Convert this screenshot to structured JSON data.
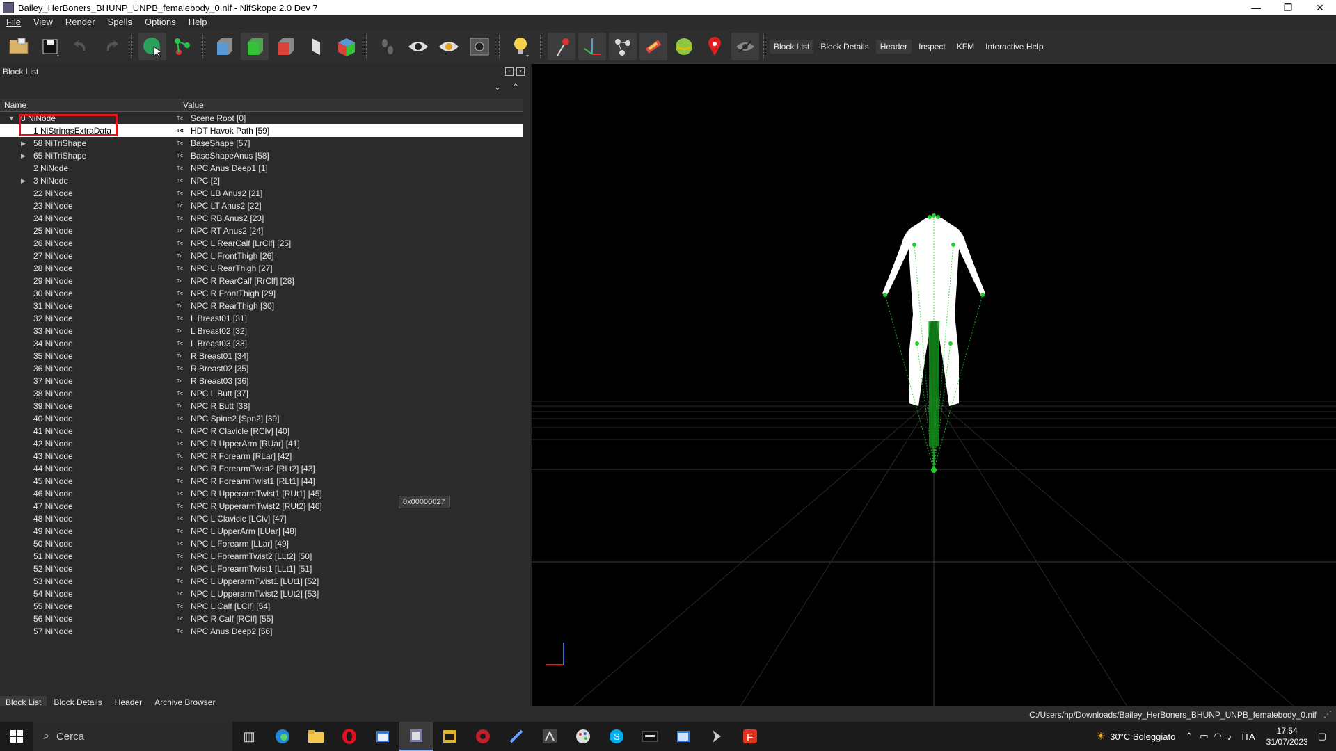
{
  "window": {
    "title": "Bailey_HerBoners_BHUNP_UNPB_femalebody_0.nif - NifSkope 2.0 Dev 7",
    "minimize": "—",
    "maximize": "❐",
    "close": "✕"
  },
  "menu": [
    "File",
    "View",
    "Render",
    "Spells",
    "Options",
    "Help"
  ],
  "toolbar_tabs": [
    "Block List",
    "Block Details",
    "Header",
    "Inspect",
    "KFM",
    "Interactive Help"
  ],
  "panel": {
    "title": "Block List",
    "col_name": "Name",
    "col_value": "Value",
    "rows": [
      {
        "name": "0 NiNode",
        "value": "Scene Root [0]",
        "type": "Txt"
      },
      {
        "name": "1 NiStringsExtraData",
        "value": "HDT Havok Path [59]",
        "type": "Txt"
      },
      {
        "name": "58 NiTriShape",
        "value": "BaseShape [57]",
        "type": "Txt"
      },
      {
        "name": "65 NiTriShape",
        "value": "BaseShapeAnus [58]",
        "type": "Txt"
      },
      {
        "name": "2 NiNode",
        "value": "NPC Anus Deep1 [1]",
        "type": "Txt"
      },
      {
        "name": "3 NiNode",
        "value": "NPC [2]",
        "type": "Txt"
      },
      {
        "name": "22 NiNode",
        "value": "NPC LB Anus2 [21]",
        "type": "Txt"
      },
      {
        "name": "23 NiNode",
        "value": "NPC LT Anus2 [22]",
        "type": "Txt"
      },
      {
        "name": "24 NiNode",
        "value": "NPC RB Anus2 [23]",
        "type": "Txt"
      },
      {
        "name": "25 NiNode",
        "value": "NPC RT Anus2 [24]",
        "type": "Txt"
      },
      {
        "name": "26 NiNode",
        "value": "NPC L RearCalf [LrClf] [25]",
        "type": "Txt"
      },
      {
        "name": "27 NiNode",
        "value": "NPC L FrontThigh [26]",
        "type": "Txt"
      },
      {
        "name": "28 NiNode",
        "value": "NPC L RearThigh [27]",
        "type": "Txt"
      },
      {
        "name": "29 NiNode",
        "value": "NPC R RearCalf [RrClf] [28]",
        "type": "Txt"
      },
      {
        "name": "30 NiNode",
        "value": "NPC R FrontThigh [29]",
        "type": "Txt"
      },
      {
        "name": "31 NiNode",
        "value": "NPC R RearThigh [30]",
        "type": "Txt"
      },
      {
        "name": "32 NiNode",
        "value": "L Breast01 [31]",
        "type": "Txt"
      },
      {
        "name": "33 NiNode",
        "value": "L Breast02 [32]",
        "type": "Txt"
      },
      {
        "name": "34 NiNode",
        "value": "L Breast03 [33]",
        "type": "Txt"
      },
      {
        "name": "35 NiNode",
        "value": "R Breast01 [34]",
        "type": "Txt"
      },
      {
        "name": "36 NiNode",
        "value": "R Breast02 [35]",
        "type": "Txt"
      },
      {
        "name": "37 NiNode",
        "value": "R Breast03 [36]",
        "type": "Txt"
      },
      {
        "name": "38 NiNode",
        "value": "NPC L Butt [37]",
        "type": "Txt"
      },
      {
        "name": "39 NiNode",
        "value": "NPC R Butt [38]",
        "type": "Txt"
      },
      {
        "name": "40 NiNode",
        "value": "NPC Spine2 [Spn2] [39]",
        "type": "Txt"
      },
      {
        "name": "41 NiNode",
        "value": "NPC R Clavicle [RClv] [40]",
        "type": "Txt"
      },
      {
        "name": "42 NiNode",
        "value": "NPC R UpperArm [RUar] [41]",
        "type": "Txt"
      },
      {
        "name": "43 NiNode",
        "value": "NPC R Forearm [RLar] [42]",
        "type": "Txt"
      },
      {
        "name": "44 NiNode",
        "value": "NPC R ForearmTwist2 [RLt2] [43]",
        "type": "Txt"
      },
      {
        "name": "45 NiNode",
        "value": "NPC R ForearmTwist1 [RLt1] [44]",
        "type": "Txt"
      },
      {
        "name": "46 NiNode",
        "value": "NPC R UpperarmTwist1 [RUt1] [45]",
        "type": "Txt"
      },
      {
        "name": "47 NiNode",
        "value": "NPC R UpperarmTwist2 [RUt2] [46]",
        "type": "Txt"
      },
      {
        "name": "48 NiNode",
        "value": "NPC L Clavicle [LClv] [47]",
        "type": "Txt"
      },
      {
        "name": "49 NiNode",
        "value": "NPC L UpperArm [LUar] [48]",
        "type": "Txt"
      },
      {
        "name": "50 NiNode",
        "value": "NPC L Forearm [LLar] [49]",
        "type": "Txt"
      },
      {
        "name": "51 NiNode",
        "value": "NPC L ForearmTwist2 [LLt2] [50]",
        "type": "Txt"
      },
      {
        "name": "52 NiNode",
        "value": "NPC L ForearmTwist1 [LLt1] [51]",
        "type": "Txt"
      },
      {
        "name": "53 NiNode",
        "value": "NPC L UpperarmTwist1 [LUt1] [52]",
        "type": "Txt"
      },
      {
        "name": "54 NiNode",
        "value": "NPC L UpperarmTwist2 [LUt2] [53]",
        "type": "Txt"
      },
      {
        "name": "55 NiNode",
        "value": "NPC L Calf [LClf] [54]",
        "type": "Txt"
      },
      {
        "name": "56 NiNode",
        "value": "NPC R Calf [RClf] [55]",
        "type": "Txt"
      },
      {
        "name": "57 NiNode",
        "value": "NPC Anus Deep2 [56]",
        "type": "Txt"
      }
    ],
    "expandable_rows": [
      0,
      2,
      3,
      5
    ],
    "selected_row": 1,
    "tooltip": "0x00000027"
  },
  "bottom_tabs": [
    "Block List",
    "Block Details",
    "Header",
    "Archive Browser"
  ],
  "status": {
    "path": "C:/Users/hp/Downloads/Bailey_HerBoners_BHUNP_UNPB_femalebody_0.nif"
  },
  "taskbar": {
    "search_placeholder": "Cerca",
    "weather": "30°C  Soleggiato",
    "lang": "ITA",
    "time": "17:54",
    "date": "31/07/2023"
  },
  "colors": {
    "accent_red": "#e0141b",
    "bone_green": "#1fd12b",
    "body_white": "#ffffff"
  }
}
